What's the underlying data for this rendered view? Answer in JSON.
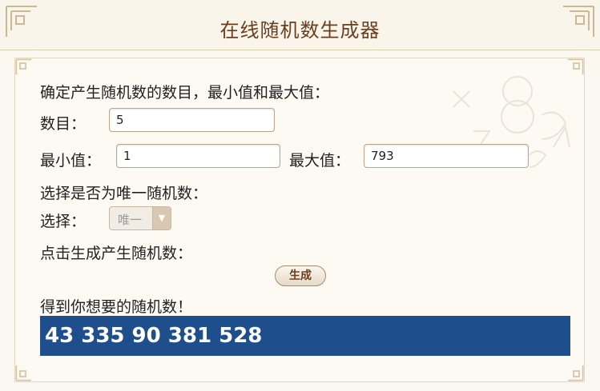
{
  "header": {
    "title": "在线随机数生成器"
  },
  "form": {
    "intro": "确定产生随机数的数目，最小值和最大值：",
    "count_label": "数目：",
    "count_value": "5",
    "min_label": "最小值：",
    "min_value": "1",
    "max_label": "最大值：",
    "max_value": "793",
    "unique_prompt": "选择是否为唯一随机数：",
    "choose_label": "选择：",
    "choose_value": "唯一",
    "generate_prompt": "点击生成产生随机数：",
    "generate_button": "生成",
    "result_prompt": "得到你想要的随机数！",
    "result_value": "43 335 90 381 528"
  },
  "colors": {
    "title": "#6b3e1e",
    "result_background": "#1f4e8c",
    "page_background": "#fbf8f1"
  }
}
